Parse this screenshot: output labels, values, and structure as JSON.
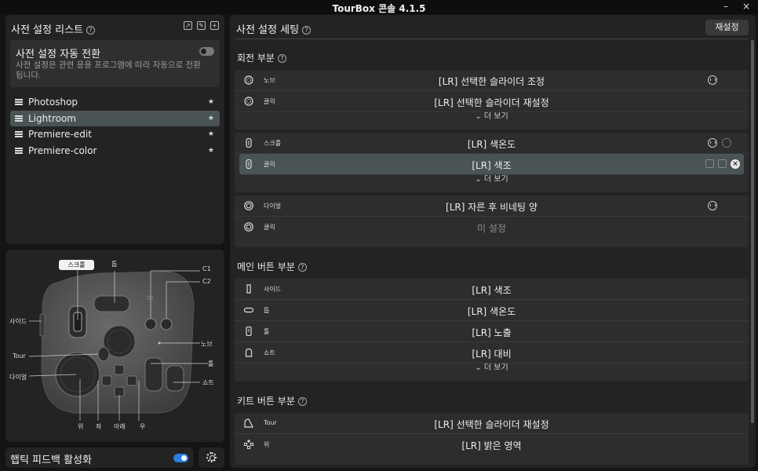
{
  "window": {
    "title": "TourBox 콘솔 4.1.5",
    "minimize": "–",
    "close": "×"
  },
  "presets": {
    "title": "사전 설정 리스트",
    "help": "?",
    "auto_switch": {
      "title": "사전 설정 자동 전환",
      "desc": "사전 설정은 관련 응용 프로그램에 따라 자동으로 전환됩니다.",
      "enabled": false
    },
    "items": [
      {
        "label": "Photoshop",
        "selected": false
      },
      {
        "label": "Lightroom",
        "selected": true
      },
      {
        "label": "Premiere-edit",
        "selected": false
      },
      {
        "label": "Premiere-color",
        "selected": false
      }
    ]
  },
  "device": {
    "scroll_chip": "스크롤",
    "labels": {
      "top": "톱",
      "c1": "C1",
      "c2": "C2",
      "side": "사이드",
      "knob": "노브",
      "tour": "Tour",
      "tall": "톨",
      "dial": "다이얼",
      "short": "쇼트",
      "up": "위",
      "left": "좌",
      "down": "아래",
      "right": "우"
    }
  },
  "haptic": {
    "label": "햅틱 피드백 활성화",
    "enabled": true
  },
  "settings": {
    "title": "사전 설정 세팅",
    "reset": "재설정",
    "sections": [
      {
        "title": "회전 부분"
      },
      {
        "title": "메인 버튼 부분"
      },
      {
        "title": "키트 버튼 부분"
      }
    ],
    "knob_group": [
      {
        "name": "노브",
        "action": "[LR] 선택한 슬라이더 조정"
      },
      {
        "name": "클릭",
        "action": "[LR] 선택한 슬라이더 재설정"
      }
    ],
    "scroll_group": [
      {
        "name": "스크롤",
        "action": "[LR] 색온도"
      },
      {
        "name": "클릭",
        "action": "[LR] 색조"
      }
    ],
    "dial_group": [
      {
        "name": "다이얼",
        "action": "[LR] 자른 후 비네팅 양"
      },
      {
        "name": "클릭",
        "action": "미 설정"
      }
    ],
    "main_group": [
      {
        "name": "사이드",
        "action": "[LR] 색조"
      },
      {
        "name": "톱",
        "action": "[LR] 색온도"
      },
      {
        "name": "톨",
        "action": "[LR] 노출"
      },
      {
        "name": "쇼트",
        "action": "[LR] 대비"
      }
    ],
    "kit_group": [
      {
        "name": "Tour",
        "action": "[LR] 선택한 슬라이더 재설정"
      },
      {
        "name": "위",
        "action": "[LR] 밝은 영역"
      }
    ],
    "more": "⌄ 더 보기"
  }
}
